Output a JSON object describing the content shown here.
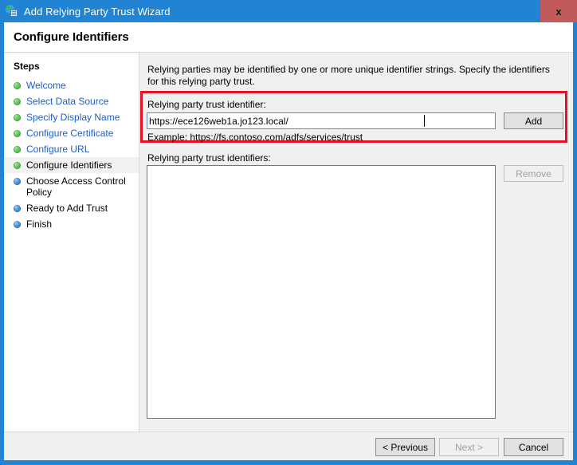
{
  "window": {
    "title": "Add Relying Party Trust Wizard",
    "icon": "relying-party-trust-icon",
    "close_label": "x",
    "accent_color": "#2083d4",
    "close_color": "#c15b5b"
  },
  "header": {
    "page_title": "Configure Identifiers"
  },
  "sidebar": {
    "heading": "Steps",
    "items": [
      {
        "label": "Welcome",
        "state": "done",
        "bullet": "green"
      },
      {
        "label": "Select Data Source",
        "state": "done",
        "bullet": "green"
      },
      {
        "label": "Specify Display Name",
        "state": "done",
        "bullet": "green"
      },
      {
        "label": "Configure Certificate",
        "state": "done",
        "bullet": "green"
      },
      {
        "label": "Configure URL",
        "state": "done",
        "bullet": "green"
      },
      {
        "label": "Configure Identifiers",
        "state": "current",
        "bullet": "green"
      },
      {
        "label": "Choose Access Control Policy",
        "state": "todo",
        "bullet": "blue"
      },
      {
        "label": "Ready to Add Trust",
        "state": "todo",
        "bullet": "blue"
      },
      {
        "label": "Finish",
        "state": "todo",
        "bullet": "blue"
      }
    ]
  },
  "content": {
    "intro": "Relying parties may be identified by one or more unique identifier strings. Specify the identifiers for this relying party trust.",
    "identifier_label": "Relying party trust identifier:",
    "identifier_value": "https://ece126web1a.jo123.local/",
    "identifier_placeholder": "",
    "add_label": "Add",
    "example": "Example: https://fs.contoso.com/adfs/services/trust",
    "identifiers_list_label": "Relying party trust identifiers:",
    "identifiers_list_items": [],
    "remove_label": "Remove",
    "highlight_color": "#e81123"
  },
  "footer": {
    "previous_label": "< Previous",
    "next_label": "Next >",
    "cancel_label": "Cancel"
  }
}
